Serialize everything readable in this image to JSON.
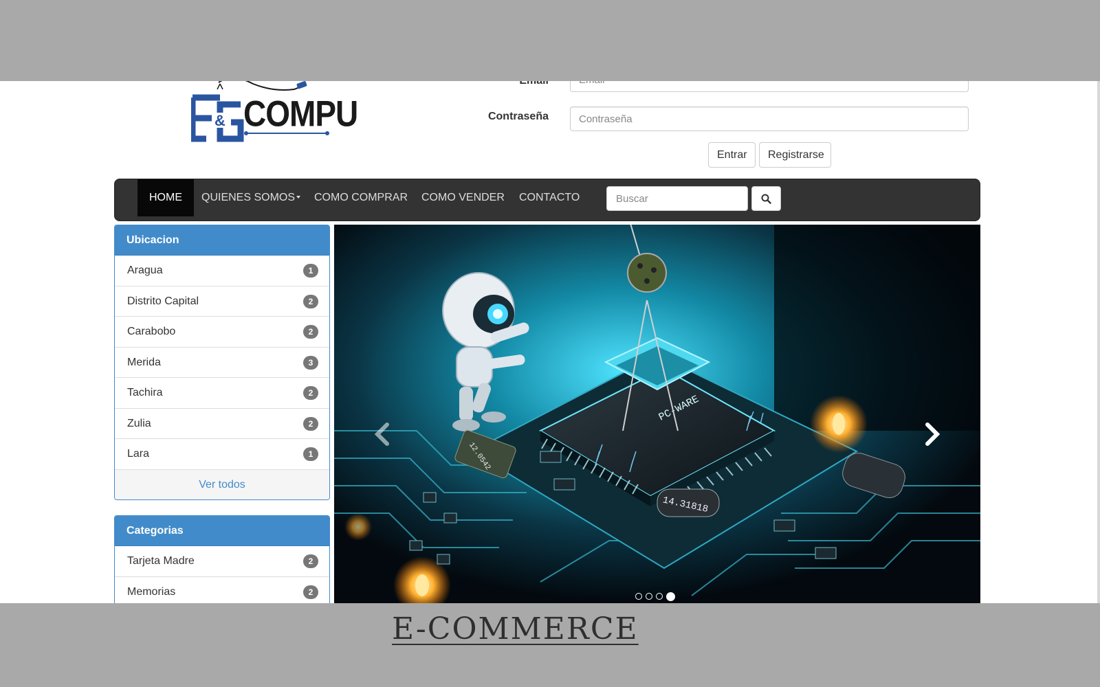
{
  "logo": {
    "text": "COMPU",
    "monogram": "F&G",
    "colors": {
      "blue": "#2a55a0",
      "dark": "#1a1a1a"
    }
  },
  "login": {
    "email_label": "Email",
    "email_placeholder": "Email",
    "password_label": "Contraseña",
    "password_placeholder": "Contraseña",
    "login_button": "Entrar",
    "register_button": "Registrarse"
  },
  "navbar": {
    "items": [
      {
        "label": "HOME",
        "active": true
      },
      {
        "label": "QUIENES SOMOS",
        "dropdown": true
      },
      {
        "label": "COMO COMPRAR"
      },
      {
        "label": "COMO VENDER"
      },
      {
        "label": "CONTACTO"
      }
    ],
    "search_placeholder": "Buscar",
    "search_icon": "search-icon"
  },
  "ubicacion": {
    "title": "Ubicacion",
    "items": [
      {
        "label": "Aragua",
        "count": "1"
      },
      {
        "label": "Distrito Capital",
        "count": "2"
      },
      {
        "label": "Carabobo",
        "count": "2"
      },
      {
        "label": "Merida",
        "count": "3"
      },
      {
        "label": "Tachira",
        "count": "2"
      },
      {
        "label": "Zulia",
        "count": "2"
      },
      {
        "label": "Lara",
        "count": "1"
      }
    ],
    "footer_link": "Ver todos"
  },
  "categorias": {
    "title": "Categorias",
    "items": [
      {
        "label": "Tarjeta Madre",
        "count": "2"
      },
      {
        "label": "Memorias",
        "count": "2"
      }
    ]
  },
  "carousel": {
    "chip_labels": [
      "PC-WARE",
      "14.31818",
      "12.0542"
    ],
    "slide_count": 4,
    "active_slide": 4,
    "prev_icon": "chevron-left-icon",
    "next_icon": "chevron-right-icon"
  },
  "caption": "E-COMMERCE",
  "colors": {
    "primary": "#428bca",
    "navbar": "#333333",
    "badge": "#777777",
    "backdrop": "#a9a9a9"
  }
}
